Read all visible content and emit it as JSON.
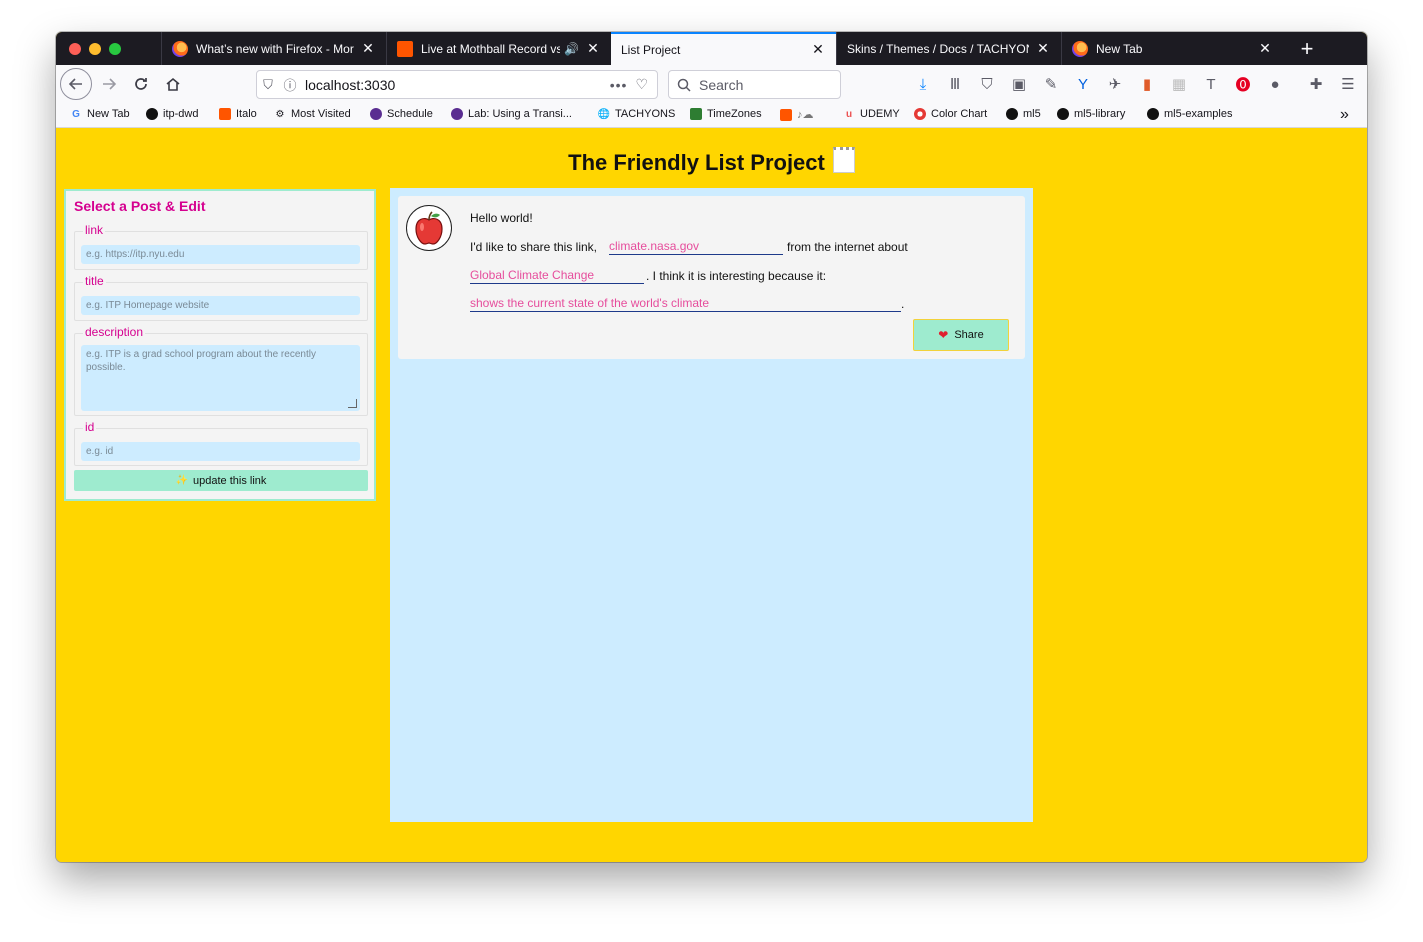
{
  "browser": {
    "tabs": [
      {
        "title": "What’s new with Firefox - More",
        "favicon": "firefox-icon",
        "active": false
      },
      {
        "title": "Live at Mothball Record vs D",
        "favicon": "soundcloud-icon",
        "active": false,
        "audio": true
      },
      {
        "title": "List Project",
        "favicon": "",
        "active": true
      },
      {
        "title": "Skins / Themes / Docs / TACHYONS",
        "favicon": "",
        "active": false
      },
      {
        "title": "New Tab",
        "favicon": "firefox-icon",
        "active": false
      }
    ],
    "url": "localhost:3030",
    "search_placeholder": "Search",
    "bookmarks": [
      {
        "label": "New Tab",
        "icon": "google-icon"
      },
      {
        "label": "itp-dwd",
        "icon": "github-icon"
      },
      {
        "label": "Italo",
        "icon": "soundcloud-icon"
      },
      {
        "label": "Most Visited",
        "icon": "gear-icon"
      },
      {
        "label": "Schedule",
        "icon": "itp-icon"
      },
      {
        "label": "Lab: Using a Transi...",
        "icon": "itp-icon"
      },
      {
        "label": "TACHYONS",
        "icon": "globe-icon"
      },
      {
        "label": "TimeZones",
        "icon": "timezones-icon"
      },
      {
        "label": "",
        "icon": "soundcloud-icon"
      },
      {
        "label": "UDEMY",
        "icon": "udemy-icon"
      },
      {
        "label": "Color Chart",
        "icon": "color-chart-icon"
      },
      {
        "label": "ml5",
        "icon": "github-icon"
      },
      {
        "label": "ml5-library",
        "icon": "github-icon"
      },
      {
        "label": "ml5-examples",
        "icon": "github-icon"
      }
    ]
  },
  "page": {
    "title": "The Friendly List Project",
    "edit_panel": {
      "heading": "Select a Post & Edit",
      "fields": [
        {
          "legend": "link",
          "placeholder": "e.g. https://itp.nyu.edu"
        },
        {
          "legend": "title",
          "placeholder": "e.g. ITP Homepage website"
        },
        {
          "legend": "description",
          "placeholder": "e.g. ITP is a grad school program about the recently possible."
        },
        {
          "legend": "id",
          "placeholder": "e.g. id"
        }
      ],
      "update_button": "update this link"
    },
    "post": {
      "greeting": "Hello world!",
      "line1_prefix": "I'd like to share this link,",
      "link_value": "climate.nasa.gov",
      "line1_suffix": "from the internet about",
      "topic_value": "Global Climate Change",
      "line2_suffix": ". I think it is interesting because it:",
      "reason_value": "shows the current state of the world's climate",
      "line3_suffix": ".",
      "share_button": "Share"
    }
  },
  "colors": {
    "page_bg": "#ffd600",
    "accent_pink": "#d5008f",
    "feed_bg": "#cdecff",
    "button_green": "#9eebcf"
  }
}
